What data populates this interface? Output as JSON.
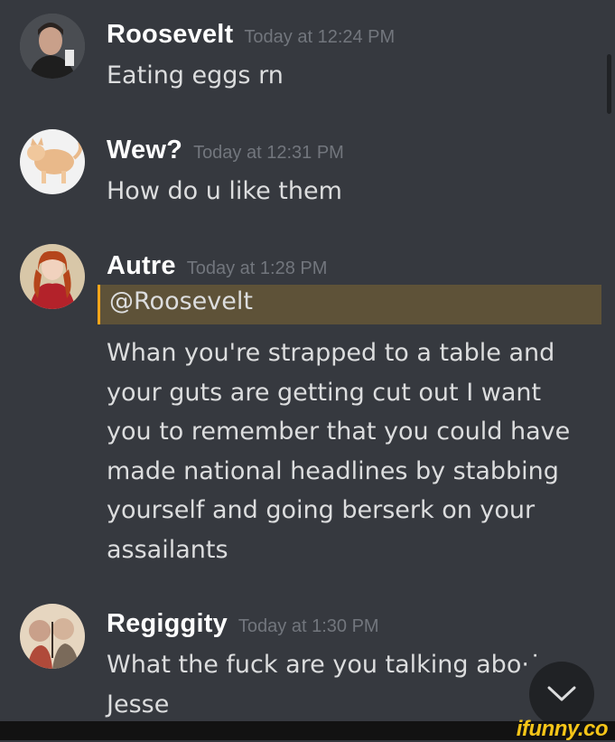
{
  "messages": [
    {
      "username": "Roosevelt",
      "timestamp": "Today at 12:24 PM",
      "lines": [
        "Eating eggs rn"
      ]
    },
    {
      "username": "Wew?",
      "timestamp": "Today at 12:31 PM",
      "lines": [
        "How do u like them"
      ]
    },
    {
      "username": "Autre",
      "timestamp": "Today at 1:28 PM",
      "mention": "@Roosevelt",
      "lines": [
        "Whan you're strapped to a table and",
        "your guts are getting cut out I want",
        "you to remember that you could have",
        "made national headlines by stabbing",
        "yourself and going berserk on your",
        "assailants"
      ]
    },
    {
      "username": "Regiggity",
      "timestamp": "Today at 1:30 PM",
      "lines": [
        "What the fuck are you talking abo·˙",
        "Jesse"
      ]
    }
  ],
  "jump_button": {
    "icon": "chevron-down-icon"
  },
  "watermark": "ifunny.co",
  "colors": {
    "background": "#36393f",
    "username": "#ffffff",
    "timestamp": "#72767d",
    "message_text": "#dcddde",
    "mention_highlight": "#5e5238",
    "mention_border": "#faa61a",
    "watermark": "#f5c518"
  }
}
